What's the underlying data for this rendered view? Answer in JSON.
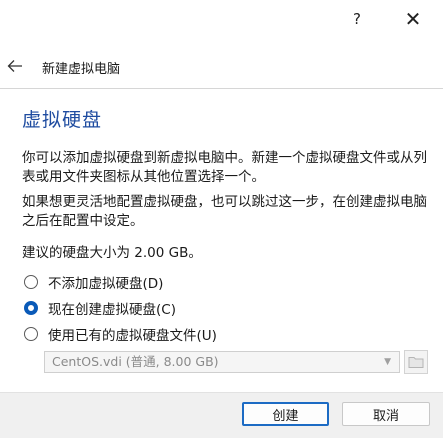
{
  "window": {
    "help_glyph": "?",
    "close_glyph": "✕"
  },
  "nav": {
    "back_glyph": "←",
    "title": "新建虚拟电脑"
  },
  "page": {
    "heading": "虚拟硬盘",
    "description_1": "你可以添加虚拟硬盘到新虚拟电脑中。新建一个虚拟硬盘文件或从列表或用文件夹图标从其他位置选择一个。",
    "description_2": "如果想更灵活地配置虚拟硬盘，也可以跳过这一步，在创建虚拟电脑之后在配置中设定。",
    "recommended": "建议的硬盘大小为 2.00 GB。"
  },
  "options": [
    {
      "label": "不添加虚拟硬盘(D)",
      "checked": false
    },
    {
      "label": "现在创建虚拟硬盘(C)",
      "checked": true
    },
    {
      "label": "使用已有的虚拟硬盘文件(U)",
      "checked": false
    }
  ],
  "existing_disk": {
    "value": "CentOS.vdi (普通, 8.00 GB)",
    "enabled": false
  },
  "buttons": {
    "create": "创建",
    "cancel": "取消"
  },
  "colors": {
    "heading": "#1f4ca0",
    "accent": "#0a5ab8",
    "default_button_border": "#1c6bc4"
  }
}
